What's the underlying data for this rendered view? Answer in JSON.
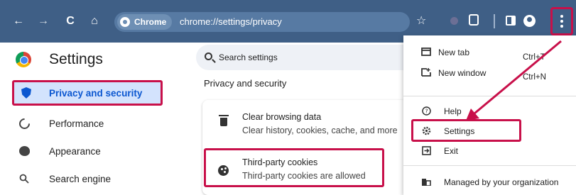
{
  "toolbar": {
    "back_icon": "←",
    "forward_icon": "→",
    "reload_icon": "C",
    "home_icon": "⌂",
    "chip_label": "Chrome",
    "url": "chrome://settings/privacy",
    "star_icon": "☆"
  },
  "sidebar": {
    "title": "Settings",
    "items": [
      {
        "label": "Privacy and security",
        "icon": "shield-icon",
        "active": true
      },
      {
        "label": "Performance",
        "icon": "speedometer-icon"
      },
      {
        "label": "Appearance",
        "icon": "palette-icon"
      },
      {
        "label": "Search engine",
        "icon": "search-icon"
      }
    ]
  },
  "main": {
    "search_placeholder": "Search settings",
    "section_title": "Privacy and security",
    "rows": [
      {
        "title": "Clear browsing data",
        "subtitle": "Clear history, cookies, cache, and more"
      },
      {
        "title": "Third-party cookies",
        "subtitle": "Third-party cookies are allowed"
      }
    ]
  },
  "menu": {
    "new_tab": "New tab",
    "new_tab_shortcut": "Ctrl+T",
    "new_window": "New window",
    "new_window_shortcut": "Ctrl+N",
    "help": "Help",
    "settings": "Settings",
    "exit": "Exit",
    "managed": "Managed by your organization"
  },
  "colors": {
    "toolbar": "#3f5f86",
    "highlight": "#c8104a",
    "active_nav_bg": "#d3e3fd",
    "active_nav_text": "#0b57d0"
  }
}
